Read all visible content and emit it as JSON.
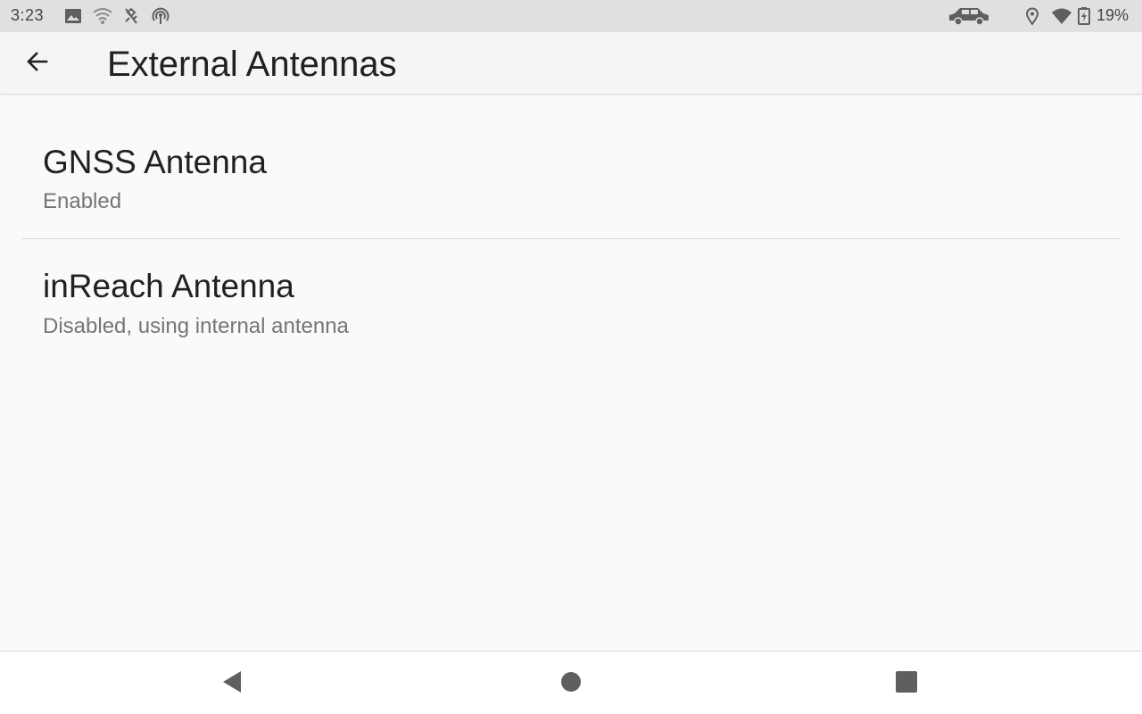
{
  "status_bar": {
    "time": "3:23",
    "battery_percent": "19%",
    "icons": [
      "image-icon",
      "wifi-icon",
      "satellite-off-icon",
      "hotspot-icon",
      "car-icon",
      "location-icon",
      "wifi-signal-icon",
      "battery-charging-icon"
    ]
  },
  "app_bar": {
    "title": "External Antennas",
    "back_icon": "arrow-back-icon"
  },
  "preferences": [
    {
      "title": "GNSS Antenna",
      "summary": "Enabled"
    },
    {
      "title": "inReach Antenna",
      "summary": "Disabled, using internal antenna"
    }
  ],
  "nav_bar": {
    "buttons": [
      "back-triangle-icon",
      "home-circle-icon",
      "recents-square-icon"
    ]
  },
  "colors": {
    "status_bar_bg": "#e0e0e0",
    "app_bar_bg": "#f5f5f5",
    "background": "#fafafa",
    "title_text": "#212121",
    "summary_text": "#757575",
    "icon_gray": "#5f5f5f"
  }
}
